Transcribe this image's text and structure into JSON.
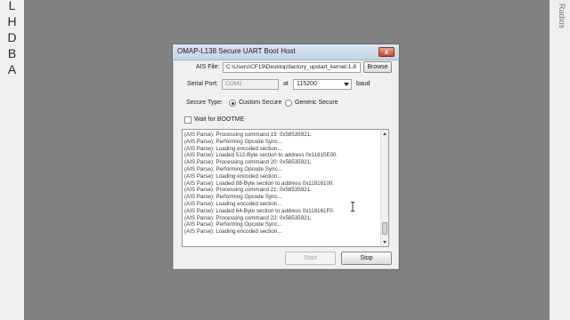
{
  "left_strip": {
    "letters": [
      "L",
      "H",
      "D",
      "B",
      "A"
    ]
  },
  "right_strip": {
    "vertical_text": "Radios"
  },
  "dialog": {
    "title": "OMAP-L138 Secure UART Boot Host",
    "close_glyph": "x",
    "ais_file": {
      "label": "AIS File:",
      "value": "C:\\Users\\CF19\\Desktop\\factory_upstart_kernel-1.8",
      "browse_label": "Browse"
    },
    "serial_port": {
      "label": "Serial Port:",
      "value": "COM1",
      "at_label": "at",
      "baud_value": "115200",
      "baud_label": "baud"
    },
    "secure_type": {
      "label": "Secure Type:",
      "options": [
        "Custom Secure",
        "Generic Secure"
      ],
      "selected": "Custom Secure"
    },
    "wait_for_bootme": {
      "label": "Wait for BOOTME",
      "checked": false
    },
    "log_lines": [
      "(AIS Parse): Processing command 19: 0x58535921.",
      "(AIS Parse): Performing Opcode Sync...",
      "(AIS Parse): Loading encoded section...",
      "(AIS Parse): Loaded 512-Byte section to address 0x11815E00.",
      "(AIS Parse): Processing command 20: 0x58535921.",
      "(AIS Parse): Performing Opcode Sync...",
      "(AIS Parse): Loading encoded section...",
      "(AIS Parse): Loaded 88-Byte section to address 0x11816100.",
      "(AIS Parse): Processing command 21: 0x58535921.",
      "(AIS Parse): Performing Opcode Sync...",
      "(AIS Parse): Loading encoded section...",
      "(AIS Parse): Loaded 64-Byte section to address 0x118161F0.",
      "(AIS Parse): Processing command 22: 0x58535921.",
      "(AIS Parse): Performing Opcode Sync...",
      "(AIS Parse): Loading encoded section..."
    ],
    "start_label": "Start",
    "stop_label": "Stop"
  },
  "colors": {
    "desktop": "#818181",
    "dialog_bg": "#f0f0f0",
    "close_button": "#c7452d"
  }
}
